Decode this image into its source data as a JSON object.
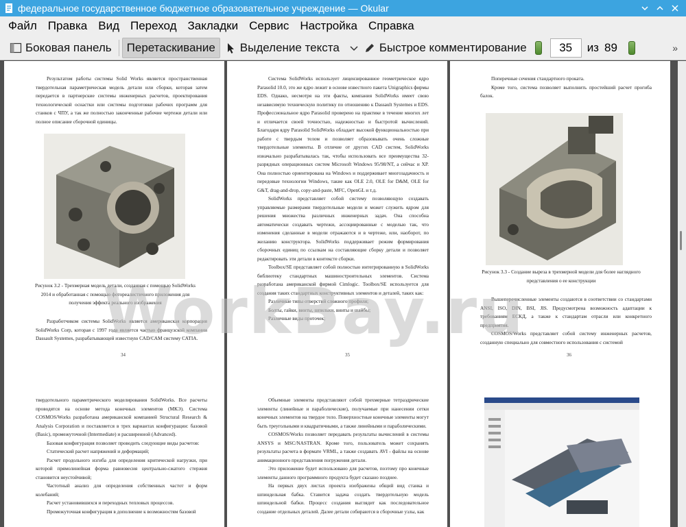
{
  "window": {
    "title": "федеральное государственное бюджетное образовательное учреждение — Okular"
  },
  "menu": [
    "Файл",
    "Правка",
    "Вид",
    "Переход",
    "Закладки",
    "Сервис",
    "Настройка",
    "Справка"
  ],
  "toolbar": {
    "sidebar_label": "Боковая панель",
    "drag_label": "Перетаскивание",
    "select_text_label": "Выделение текста",
    "quick_comment_label": "Быстрое комментирование",
    "current_page": "35",
    "of_label": "из",
    "total_pages": "89"
  },
  "watermark": "WorkBay.ru",
  "pages": {
    "p34": {
      "text1": "Результатом работы системы Solid Works является пространственная твердотельная параметрическая модель детали или сборки, которая затем передается в партнерские системы инженерных расчетов, проектирования технологической оснастки или системы подготовки рабочих программ для станков с ЧПУ, а так же полностью законченные рабочие чертежи детали или полное описание сборочной единицы.",
      "caption": "Рисунок 3.2 - Трехмерная модель детали, созданная с помощью SolidWorks 2014 и обработанная с помощью фотореалистичного приложения для получения эффекта реального изображения",
      "text2": "Разработчиком системы SolidWorks является американская корпорация SolidWorks Corp, которая с 1997 года является частью французской компании Dassault Systemes, разрабатывающей известную САD/САМ систему САТIA.",
      "num": "34"
    },
    "p35": {
      "text1": "Система SolidWorks использует лицензированное геометрическое ядро Parasolid 10.0, это же ядро лежит в основе известного пакета Unigraphics фирмы EDS. Однако, несмотря на эти факты, компания SolidWorks имеет свою независимую техническую политику по отношению к Dassault Systemes и EDS. Профессиональное ядро Parasolid проверено на практике в течение многих лет и отличается своей точностью, надежностью и быстротой вычислений. Благодаря ядру Parasolid SolidWorks обладает высокой функциональностью при работе с твердым телом и позволяет образовывать очень сложные твердотельные элементы. В отличие от других САD систем, SolidWorks изначально разрабатывалась так, чтобы использовать все преимущества 32-разрядных операционных систем Microsoft Windows 95/98/NT, а сейчас и XP. Она полностью ориентирована на Windows и поддерживает многозадачность и передовые технологии Windows, такие как OLE 2.0, OLE for D&M, OLE for G&T, drag-and-drop, copy-and-paste, MFC, OpenGL и т.д.",
      "text2": "SolidWorks представляет собой систему позволяющую создавать управляемые размерами твердотельные модели и может служить ядром для решения множества различных инженерных задач. Она способна автоматически создавать чертежи, ассоциированные с моделью так, что изменения сделанные в модели отражаются и в чертеже, или, наоборот, по желанию конструктора. SolidWorks поддерживает режим формирования сборочных единиц по ссылкам на составляющие сборку детали и позволяет редактировать эти детали в контексте сборки.",
      "text3": "Toolbox/SE представляет собой полностью интегрированную в SolidWorks библиотеку стандартных машиностроительных элементов. Система разработана американской фирмой Cimlogic. Toolbox/SE используется для создания таких стандартных конструктивных элементов и деталей, таких как:",
      "item1": "Различные типы отверстий сложного профиля;",
      "item2": "Болты, гайки, винты, шпильки, винты и шайбы;",
      "item3": "Различные виды проточек;",
      "num": "35"
    },
    "p36": {
      "text1": "Поперечные сечения стандартного проката.",
      "text2": "Кроме того, система позволяет выполнить простейший расчет прогиба балок.",
      "caption": "Рисунок 3.3 - Создание выреза в трехмерной модели для более наглядного представления о ее конструкции",
      "text3": "Вышеперечисленные элементы создаются в соответствии со стандартами ANSI, ISO, DIN, BSI, JIS. Предусмотрена возможность адаптации к требованиям ЕСКД, а также к стандартам отрасли или конкретного предприятия.",
      "text4": "COSMOS/Works представляет собой систему инженерных расчетов, созданную специально для совместного использования с системой",
      "num": "36"
    },
    "p37": {
      "text1": "твердотельного параметрического моделирования SolidWorks. Все расчеты проводятся на основе метода конечных элементов (МКЭ). Система COSMOS/Works разработана американской компанией Structural Research & Analysis Corporation и поставляется в трех вариантах конфигурации: базовой (Basic), промежуточной (Intermediate) и расширенной (Advanced).",
      "text2": "Базовая конфигурация позволяет проводить следующие виды расчетов:",
      "text3": "Статический расчет напряжений и деформаций;",
      "text4": "Расчет продольного изгиба для определения критической нагрузки, при которой прямолинейная форма равновесия центрально-сжатого стержня становится неустойчивой;",
      "text5": "Частотный анализ для определения собственных частот и форм колебаний;",
      "text6": "Расчет установившихся и переходных тепловых процессов.",
      "text7": "Промежуточная конфигурация в дополнение к возможностям базовой"
    },
    "p38": {
      "text1": "Объемные элементы представляют собой трехмерные тетраэдрические элементы (линейные и параболические), получаемые при нанесении сетки конечных элементов на твердое тело. Поверхностные конечные элементы могут быть треугольными и квадратичными, а также линейными и параболическими.",
      "text2": "COSMOS/Works позволяет передавать результаты вычислений в системы ANSYS и MSC/NASTRAN. Кроме того, пользователь может сохранять результаты расчета в формате VRML, а также создавать AVI - файлы на основе анимационного представления погружения детали.",
      "text3": "Это приложение будет использовано для расчетов, поэтому про конечные элементы данного программного продукта будет сказано позднее.",
      "text4": "На первых двух листах проекта изображены общий вид станка и шпиндельная бабка. Ставится задача создать твердотельную модель шпиндельной бабки. Процесс создания выглядит как последовательное создание отдельных деталей. Далее детали собираются в сборочные узлы, как"
    }
  }
}
